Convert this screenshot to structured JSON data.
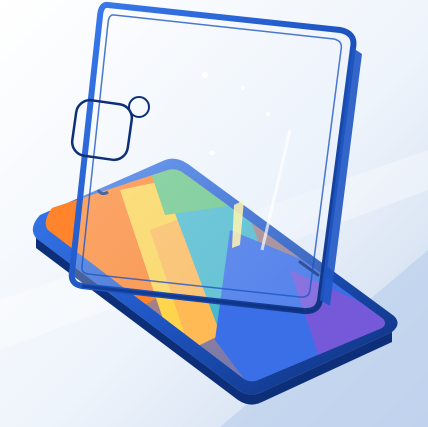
{
  "image": {
    "subject": "magnetic-double-sided-glass-phone-case",
    "colors": {
      "background_light": "#eef4fb",
      "background_mid": "#c9d8ee",
      "frame_blue": "#1f56c4",
      "frame_dark": "#0d2f7a",
      "wallpaper_orange": "#ff7a1a",
      "wallpaper_yellow": "#ffd23f",
      "wallpaper_teal": "#39b3c8",
      "wallpaper_blue": "#2b63e6",
      "wallpaper_purple": "#6a4bd6"
    }
  }
}
